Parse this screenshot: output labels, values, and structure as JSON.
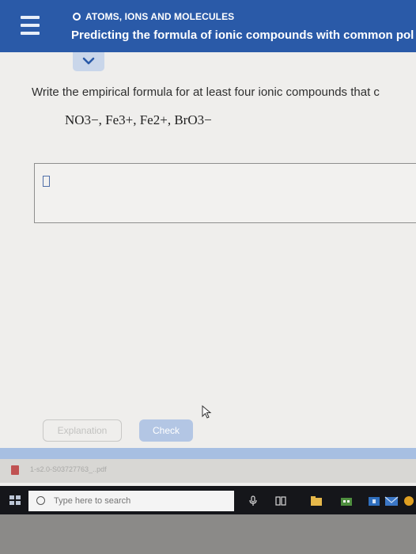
{
  "header": {
    "topic": "ATOMS, IONS AND MOLECULES",
    "title": "Predicting the formula of ionic compounds with common pol"
  },
  "question": {
    "prompt": "Write the empirical formula for at least four ionic compounds that c",
    "ions_line": "NO3−, Fe3+, Fe2+, BrO3−"
  },
  "buttons": {
    "explanation": "Explanation",
    "check": "Check"
  },
  "download_bar": {
    "filename": "1-s2.0-S03727763_..pdf"
  },
  "taskbar": {
    "search_placeholder": "Type here to search"
  },
  "colors": {
    "header": "#2a5aa8",
    "check_button": "#b3c6e4",
    "tab": "#c9d6ea"
  }
}
